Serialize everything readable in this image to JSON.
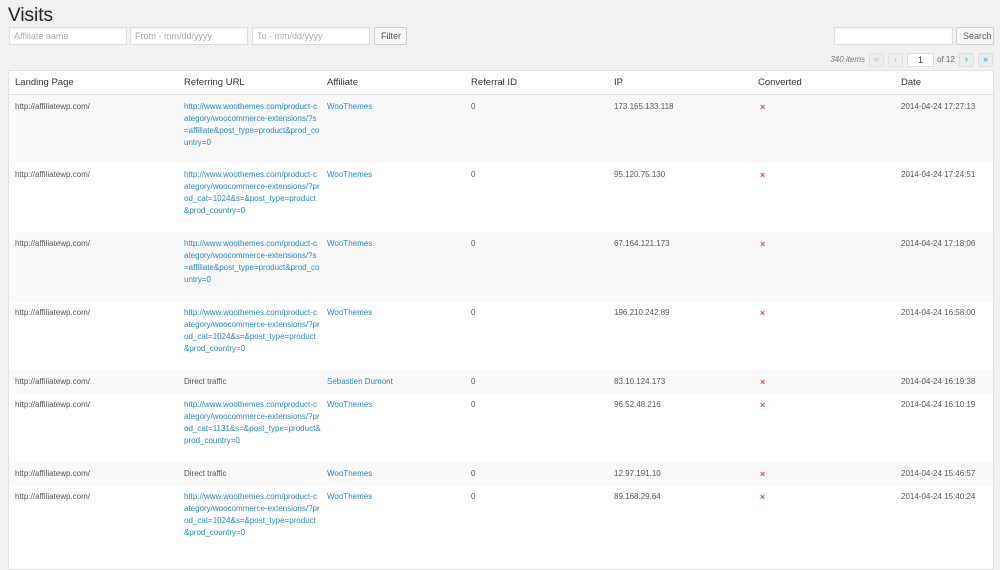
{
  "page": {
    "title": "Visits"
  },
  "filters": {
    "affiliate_placeholder": "Affiliate name",
    "from_placeholder": "From - mm/dd/yyyy",
    "to_placeholder": "To - mm/dd/yyyy",
    "filter_label": "Filter",
    "search_value": "",
    "search_label": "Search"
  },
  "pagination": {
    "items_count": "340 items",
    "first": "«",
    "prev": "‹",
    "current_page": "1",
    "of_label": "of 12",
    "next": "›",
    "last": "»"
  },
  "table": {
    "headers": {
      "landing": "Landing Page",
      "referrer": "Referring URL",
      "affiliate": "Affiliate",
      "referral_id": "Referral ID",
      "ip": "IP",
      "converted": "Converted",
      "date": "Date"
    },
    "rows": [
      {
        "landing": "http://affiliatewp.com/",
        "referrer": "http://www.woothemes.com/product-category/woocommerce-extensions/?s=affiliate&post_type=product&prod_country=0",
        "referrer_is_link": true,
        "affiliate": "WooThemes",
        "referral_id": "0",
        "ip": "173.165.133.118",
        "converted": "×",
        "date": "2014-04-24 17:27:13"
      },
      {
        "landing": "http://affiliatewp.com/",
        "referrer": "http://www.woothemes.com/product-category/woocommerce-extensions/?prod_cat=1024&s=&post_type=product&prod_country=0",
        "referrer_is_link": true,
        "affiliate": "WooThemes",
        "referral_id": "0",
        "ip": "95.120.75.130",
        "converted": "×",
        "date": "2014-04-24 17:24:51"
      },
      {
        "landing": "http://affiliatewp.com/",
        "referrer": "http://www.woothemes.com/product-category/woocommerce-extensions/?s=affiliate&post_type=product&prod_country=0",
        "referrer_is_link": true,
        "affiliate": "WooThemes",
        "referral_id": "0",
        "ip": "67.164.121.173",
        "converted": "×",
        "date": "2014-04-24 17:18:06"
      },
      {
        "landing": "http://affiliatewp.com/",
        "referrer": "http://www.woothemes.com/product-category/woocommerce-extensions/?prod_cat=1024&s=&post_type=product&prod_country=0",
        "referrer_is_link": true,
        "affiliate": "WooThemes",
        "referral_id": "0",
        "ip": "196.210.242.89",
        "converted": "×",
        "date": "2014-04-24 16:58:00"
      },
      {
        "landing": "http://affiliatewp.com/",
        "referrer": "Direct traffic",
        "referrer_is_link": false,
        "affiliate": "Sebastien Dumont",
        "referral_id": "0",
        "ip": "83.10.124.173",
        "converted": "×",
        "date": "2014-04-24 16:19:38"
      },
      {
        "landing": "http://affiliatewp.com/",
        "referrer": "http://www.woothemes.com/product-category/woocommerce-extensions/?prod_cat=1131&s=&post_type=product&prod_country=0",
        "referrer_is_link": true,
        "affiliate": "WooThemes",
        "referral_id": "0",
        "ip": "96.52.48.216",
        "converted": "×",
        "date": "2014-04-24 16:10:19"
      },
      {
        "landing": "http://affiliatewp.com/",
        "referrer": "Direct traffic",
        "referrer_is_link": false,
        "affiliate": "WooThemes",
        "referral_id": "0",
        "ip": "12.97.191.10",
        "converted": "×",
        "date": "2014-04-24 15:46:57"
      },
      {
        "landing": "http://affiliatewp.com/",
        "referrer": "http://www.woothemes.com/product-category/woocommerce-extensions/?prod_cat=1024&s=&post_type=product&prod_country=0",
        "referrer_is_link": true,
        "affiliate": "WooThemes",
        "referral_id": "0",
        "ip": "89.168.29.64",
        "converted": "×",
        "date": "2014-04-24 15:40:24"
      }
    ]
  },
  "colors": {
    "link": "#2a87c0",
    "not_converted": "#e14d43",
    "row_alt": "#f9f9f9"
  }
}
